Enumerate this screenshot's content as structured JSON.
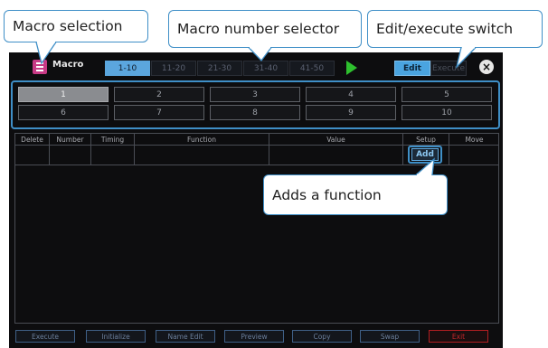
{
  "callouts": {
    "macro_selection": "Macro selection",
    "macro_number_selector": "Macro number selector",
    "edit_execute_switch": "Edit/execute switch",
    "adds_function": "Adds a function"
  },
  "header": {
    "title": "Macro",
    "tabs": [
      "1-10",
      "11-20",
      "21-30",
      "31-40",
      "41-50"
    ],
    "active_tab": "1-10",
    "edit_label": "Edit",
    "execute_label": "Execute",
    "close_label": "×"
  },
  "macros": {
    "cells": [
      "1",
      "2",
      "3",
      "4",
      "5",
      "6",
      "7",
      "8",
      "9",
      "10"
    ],
    "selected": "1"
  },
  "table": {
    "columns": [
      "Delete",
      "Number",
      "Timing",
      "Function",
      "Value",
      "Setup",
      "Move"
    ],
    "add_label": "Add"
  },
  "bottom_buttons": [
    "Execute",
    "Initialize",
    "Name Edit",
    "Preview",
    "Copy",
    "Swap",
    "Exit"
  ],
  "colors": {
    "accent": "#3f8fc7",
    "tab_active": "#5ba6de",
    "play": "#2ec02e",
    "exit": "#c3272b",
    "app_icon": "#c83a86"
  },
  "icons": {
    "app": "macro-document-icon",
    "play": "play-icon",
    "close": "close-icon"
  }
}
